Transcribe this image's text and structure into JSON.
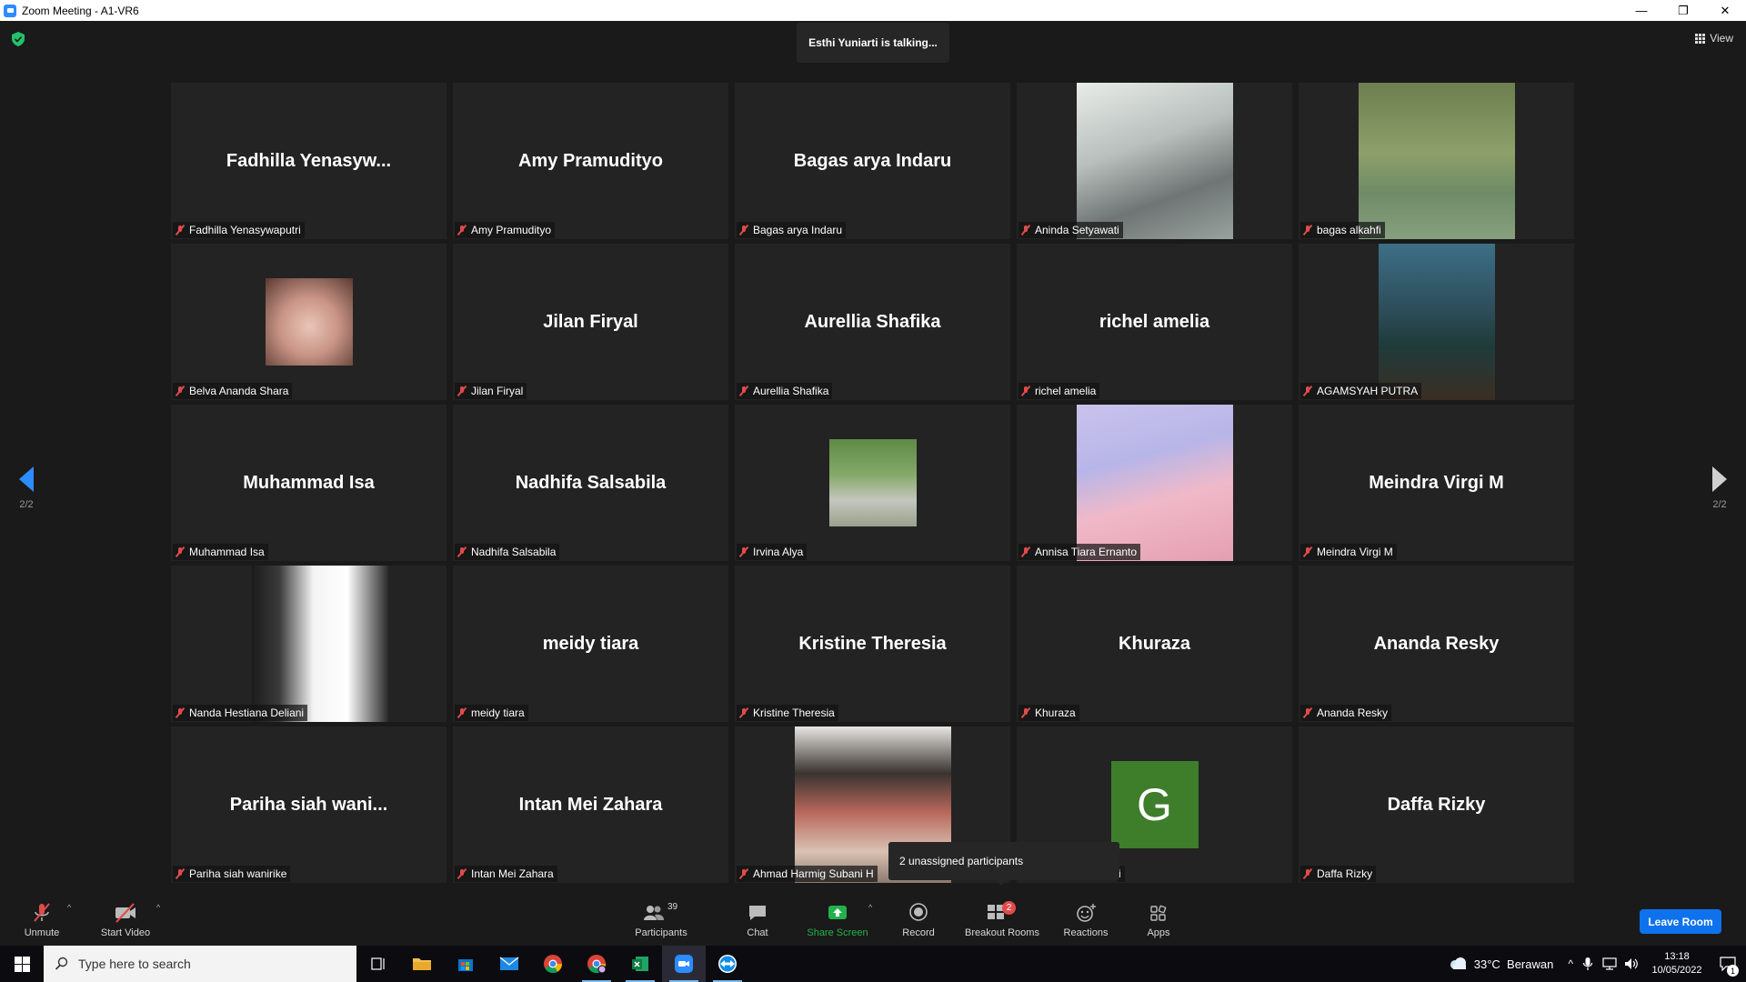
{
  "window": {
    "title": "Zoom Meeting - A1-VR6",
    "minimize": "—",
    "restore": "❐",
    "close": "✕"
  },
  "meeting": {
    "talking_banner": "Esthi Yuniarti is talking...",
    "view_label": "View",
    "page_left": "2/2",
    "page_right": "2/2",
    "unassigned_tooltip": "2 unassigned participants"
  },
  "tiles": [
    {
      "display": "Fadhilla  Yenasyw...",
      "label": "Fadhilla Yenasywaputri"
    },
    {
      "display": "Amy Pramudityo",
      "label": "Amy Pramudityo"
    },
    {
      "display": "Bagas arya Indaru",
      "label": "Bagas arya Indaru"
    },
    {
      "display": "",
      "label": "Aninda Setyawati"
    },
    {
      "display": "",
      "label": "bagas alkahfi"
    },
    {
      "display": "",
      "label": "Belva Ananda Shara"
    },
    {
      "display": "Jilan Firyal",
      "label": "Jilan Firyal"
    },
    {
      "display": "Aurellia Shafika",
      "label": "Aurellia Shafika"
    },
    {
      "display": "richel amelia",
      "label": "richel amelia"
    },
    {
      "display": "",
      "label": "AGAMSYAH PUTRA"
    },
    {
      "display": "Muhammad Isa",
      "label": "Muhammad Isa"
    },
    {
      "display": "Nadhifa Salsabila",
      "label": "Nadhifa Salsabila"
    },
    {
      "display": "",
      "label": "Irvina Alya"
    },
    {
      "display": "",
      "label": "Annisa Tiara Ernanto"
    },
    {
      "display": "Meindra Virgi M",
      "label": "Meindra Virgi M"
    },
    {
      "display": "",
      "label": "Nanda Hestiana Deliani"
    },
    {
      "display": "meidy tiara",
      "label": "meidy tiara"
    },
    {
      "display": "Kristine Theresia",
      "label": "Kristine Theresia"
    },
    {
      "display": "Khuraza",
      "label": "Khuraza"
    },
    {
      "display": "Ananda Resky",
      "label": "Ananda Resky"
    },
    {
      "display": "Pariha siah wani...",
      "label": "Pariha siah wanirike"
    },
    {
      "display": "Intan Mei Zahara",
      "label": "Intan Mei Zahara"
    },
    {
      "display": "",
      "label": "Ahmad Harmig Subani H"
    },
    {
      "display": "G",
      "label": "i"
    },
    {
      "display": "Daffa Rizky",
      "label": "Daffa Rizky"
    }
  ],
  "toolbar": {
    "unmute": "Unmute",
    "start_video": "Start Video",
    "participants": "Participants",
    "participants_count": "39",
    "chat": "Chat",
    "share_screen": "Share Screen",
    "record": "Record",
    "breakout_rooms": "Breakout Rooms",
    "breakout_badge": "2",
    "reactions": "Reactions",
    "apps": "Apps",
    "leave_room": "Leave Room",
    "caret": "^"
  },
  "taskbar": {
    "search_placeholder": "Type here to search",
    "weather": "33°C  Berawan",
    "time": "13:18",
    "date": "10/05/2022",
    "notification_count": "1"
  },
  "colors": {
    "accent": "#2d8cff",
    "muted_red": "#e04b4b",
    "share_green": "#22b14c",
    "leave_blue": "#0e72ed",
    "avatar_green": "#3e7d2a"
  }
}
